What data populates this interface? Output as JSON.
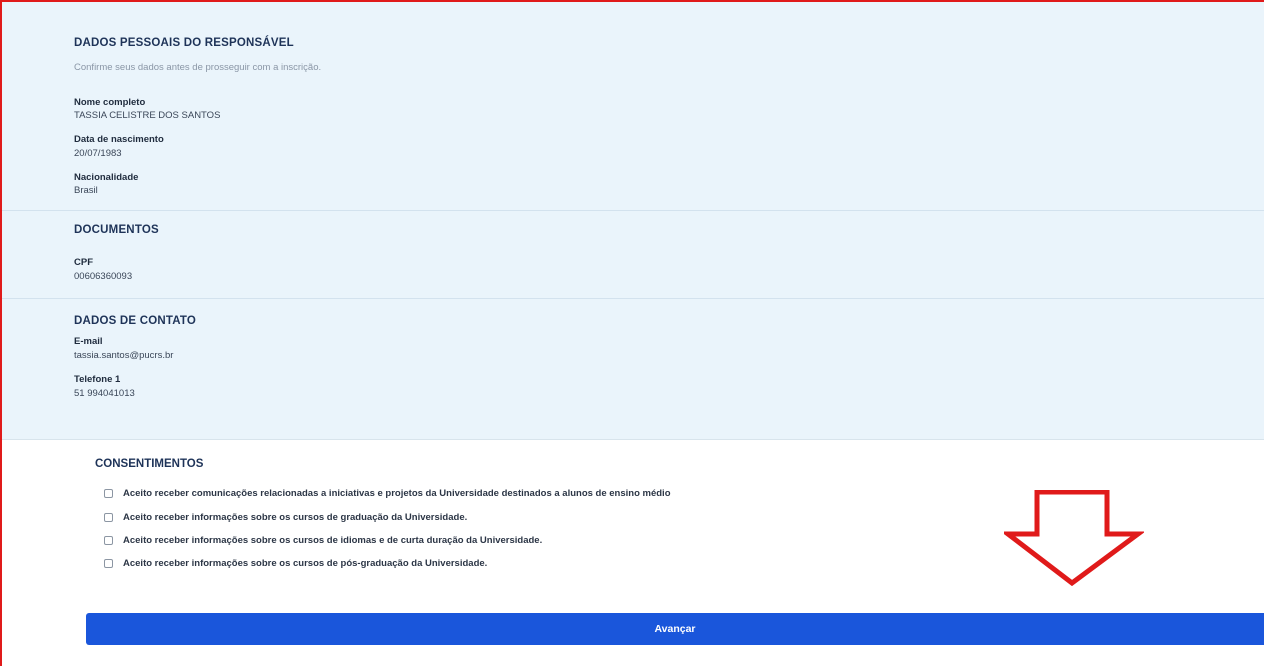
{
  "personal": {
    "title": "DADOS PESSOAIS DO RESPONSÁVEL",
    "subtitle": "Confirme seus dados antes de prosseguir com a inscrição.",
    "fields": [
      {
        "label": "Nome completo",
        "value": "TASSIA CELISTRE DOS SANTOS"
      },
      {
        "label": "Data de nascimento",
        "value": "20/07/1983"
      },
      {
        "label": "Nacionalidade",
        "value": "Brasil"
      }
    ]
  },
  "documents": {
    "title": "DOCUMENTOS",
    "fields": [
      {
        "label": "CPF",
        "value": "00606360093"
      }
    ]
  },
  "contact": {
    "title": "DADOS DE CONTATO",
    "fields": [
      {
        "label": "E-mail",
        "value": "tassia.santos@pucrs.br"
      },
      {
        "label": "Telefone 1",
        "value": "51 994041013"
      }
    ]
  },
  "consents": {
    "title": "CONSENTIMENTOS",
    "items": [
      {
        "label": "Aceito receber comunicações relacionadas a iniciativas e projetos da Universidade destinados a alunos de ensino médio",
        "checked": false
      },
      {
        "label": "Aceito receber informações sobre os cursos de graduação da Universidade.",
        "checked": false
      },
      {
        "label": "Aceito receber informações sobre os cursos de idiomas e de curta duração da Universidade.",
        "checked": false
      },
      {
        "label": "Aceito receber informações sobre os cursos de pós-graduação da Universidade.",
        "checked": false
      }
    ]
  },
  "actions": {
    "advance_label": "Avançar"
  },
  "colors": {
    "panel_background": "#eaf4fb",
    "primary_button": "#1a56db",
    "annotation_red": "#e01a1a",
    "heading_text": "#1e3358"
  }
}
